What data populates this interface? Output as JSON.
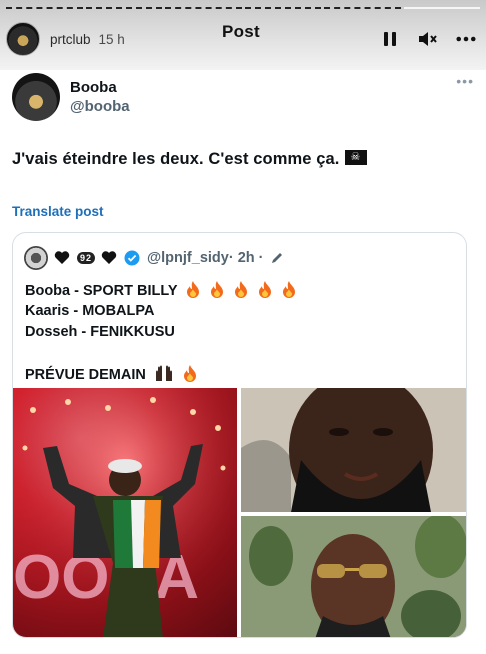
{
  "story": {
    "username": "prtclub",
    "time_ago": "15 h",
    "title": "Post"
  },
  "tweet": {
    "display_name": "Booba",
    "handle": "@booba",
    "text": "J'vais éteindre les deux. C'est comme ça.",
    "translate_label": "Translate post"
  },
  "quote": {
    "handle": "@lpnjf_sidy",
    "time": "· 2h ·",
    "badge": "92",
    "lines": [
      "Booba - SPORT BILLY",
      "Kaaris - MOBALPA",
      "Dosseh - FENIKKUSU",
      "PRÉVUE DEMAIN"
    ],
    "photo_caption": "OOBA"
  },
  "colors": {
    "link": "#1d6fb8",
    "secondary": "#536471",
    "verified": "#1d9bf0"
  },
  "icons": [
    "pause-icon",
    "mute-icon",
    "more-icon",
    "heart-icon",
    "verified-icon",
    "edit-icon",
    "fire-icon",
    "raised-hands-icon",
    "pirate-flag-icon"
  ]
}
